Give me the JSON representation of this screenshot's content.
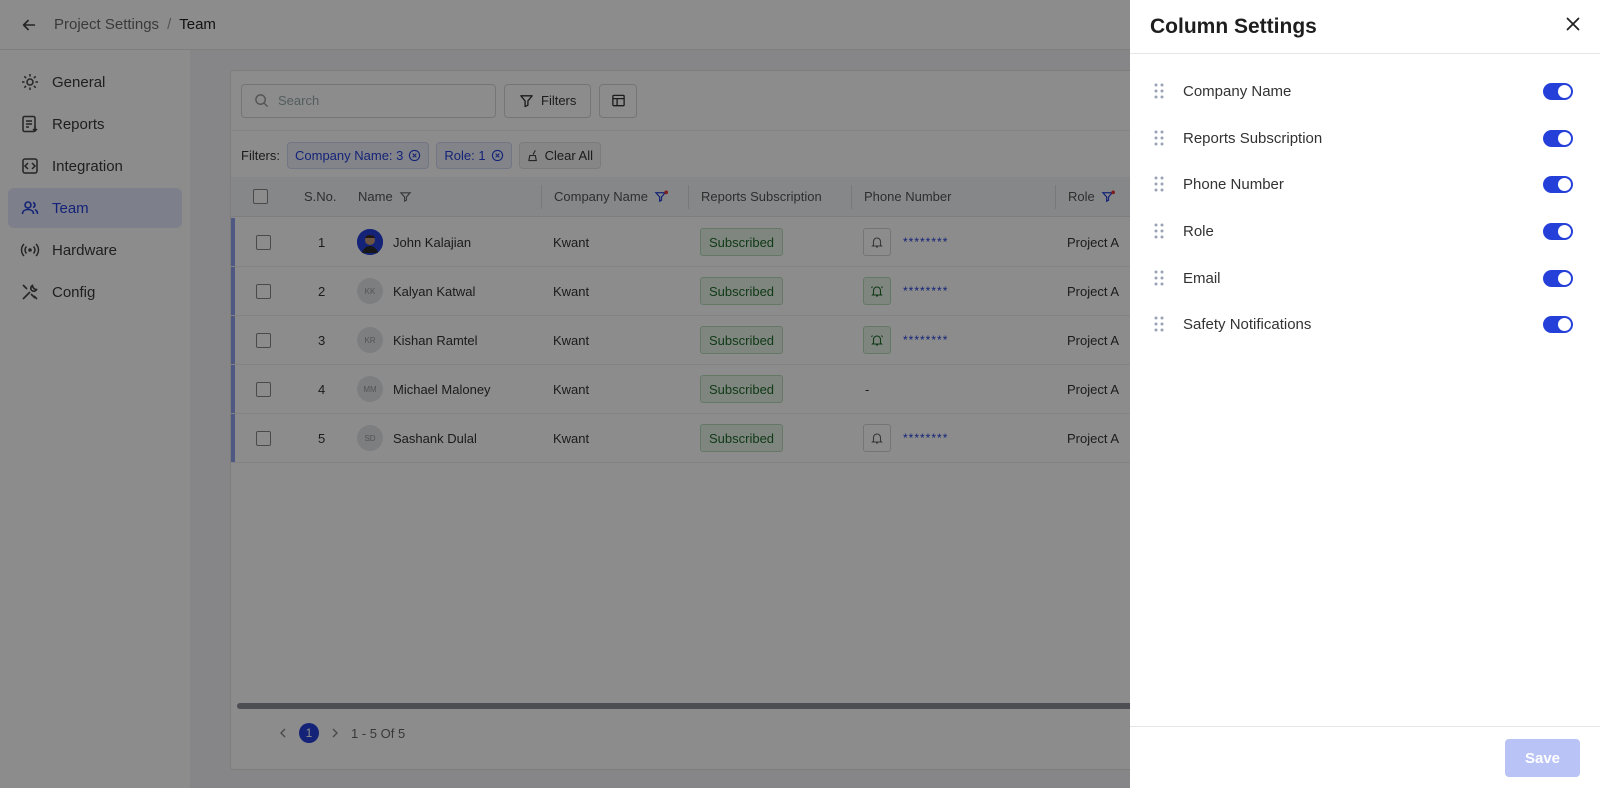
{
  "breadcrumb": {
    "parent": "Project Settings",
    "separator": "/",
    "current": "Team"
  },
  "sidebar": {
    "items": [
      {
        "label": "General",
        "icon": "gear-icon"
      },
      {
        "label": "Reports",
        "icon": "report-icon"
      },
      {
        "label": "Integration",
        "icon": "integration-icon"
      },
      {
        "label": "Team",
        "icon": "team-icon",
        "active": true
      },
      {
        "label": "Hardware",
        "icon": "broadcast-icon"
      },
      {
        "label": "Config",
        "icon": "tools-icon"
      }
    ]
  },
  "toolbar": {
    "search_placeholder": "Search",
    "filters_label": "Filters"
  },
  "filters": {
    "label": "Filters:",
    "chips": [
      "Company Name: 3",
      "Role: 1"
    ],
    "clear_label": "Clear All"
  },
  "table": {
    "columns": {
      "sno": "S.No.",
      "name": "Name",
      "company": "Company Name",
      "reports": "Reports Subscription",
      "phone": "Phone Number",
      "role": "Role"
    },
    "rows": [
      {
        "sno": "1",
        "initials": "",
        "name": "John Kalajian",
        "company": "Kwant",
        "reports": "Subscribed",
        "phone": "********",
        "role": "Project A"
      },
      {
        "sno": "2",
        "initials": "KK",
        "name": "Kalyan Katwal",
        "company": "Kwant",
        "reports": "Subscribed",
        "phone": "********",
        "role": "Project A"
      },
      {
        "sno": "3",
        "initials": "KR",
        "name": "Kishan Ramtel",
        "company": "Kwant",
        "reports": "Subscribed",
        "phone": "********",
        "role": "Project A"
      },
      {
        "sno": "4",
        "initials": "MM",
        "name": "Michael Maloney",
        "company": "Kwant",
        "reports": "Subscribed",
        "phone": "-",
        "role": "Project A"
      },
      {
        "sno": "5",
        "initials": "SD",
        "name": "Sashank Dulal",
        "company": "Kwant",
        "reports": "Subscribed",
        "phone": "********",
        "role": "Project A"
      }
    ]
  },
  "pagination": {
    "page": "1",
    "range": "1 - 5 Of 5"
  },
  "drawer": {
    "title": "Column Settings",
    "items": [
      {
        "label": "Company Name",
        "enabled": true
      },
      {
        "label": "Reports Subscription",
        "enabled": true
      },
      {
        "label": "Phone Number",
        "enabled": true
      },
      {
        "label": "Role",
        "enabled": true
      },
      {
        "label": "Email",
        "enabled": true
      },
      {
        "label": "Safety Notifications",
        "enabled": true
      }
    ],
    "save_label": "Save"
  },
  "colors": {
    "accent": "#2540d9",
    "subscribed_bg": "#e7f4e8",
    "subscribed_text": "#1f6a2b",
    "save_disabled": "#b9c3f5"
  }
}
